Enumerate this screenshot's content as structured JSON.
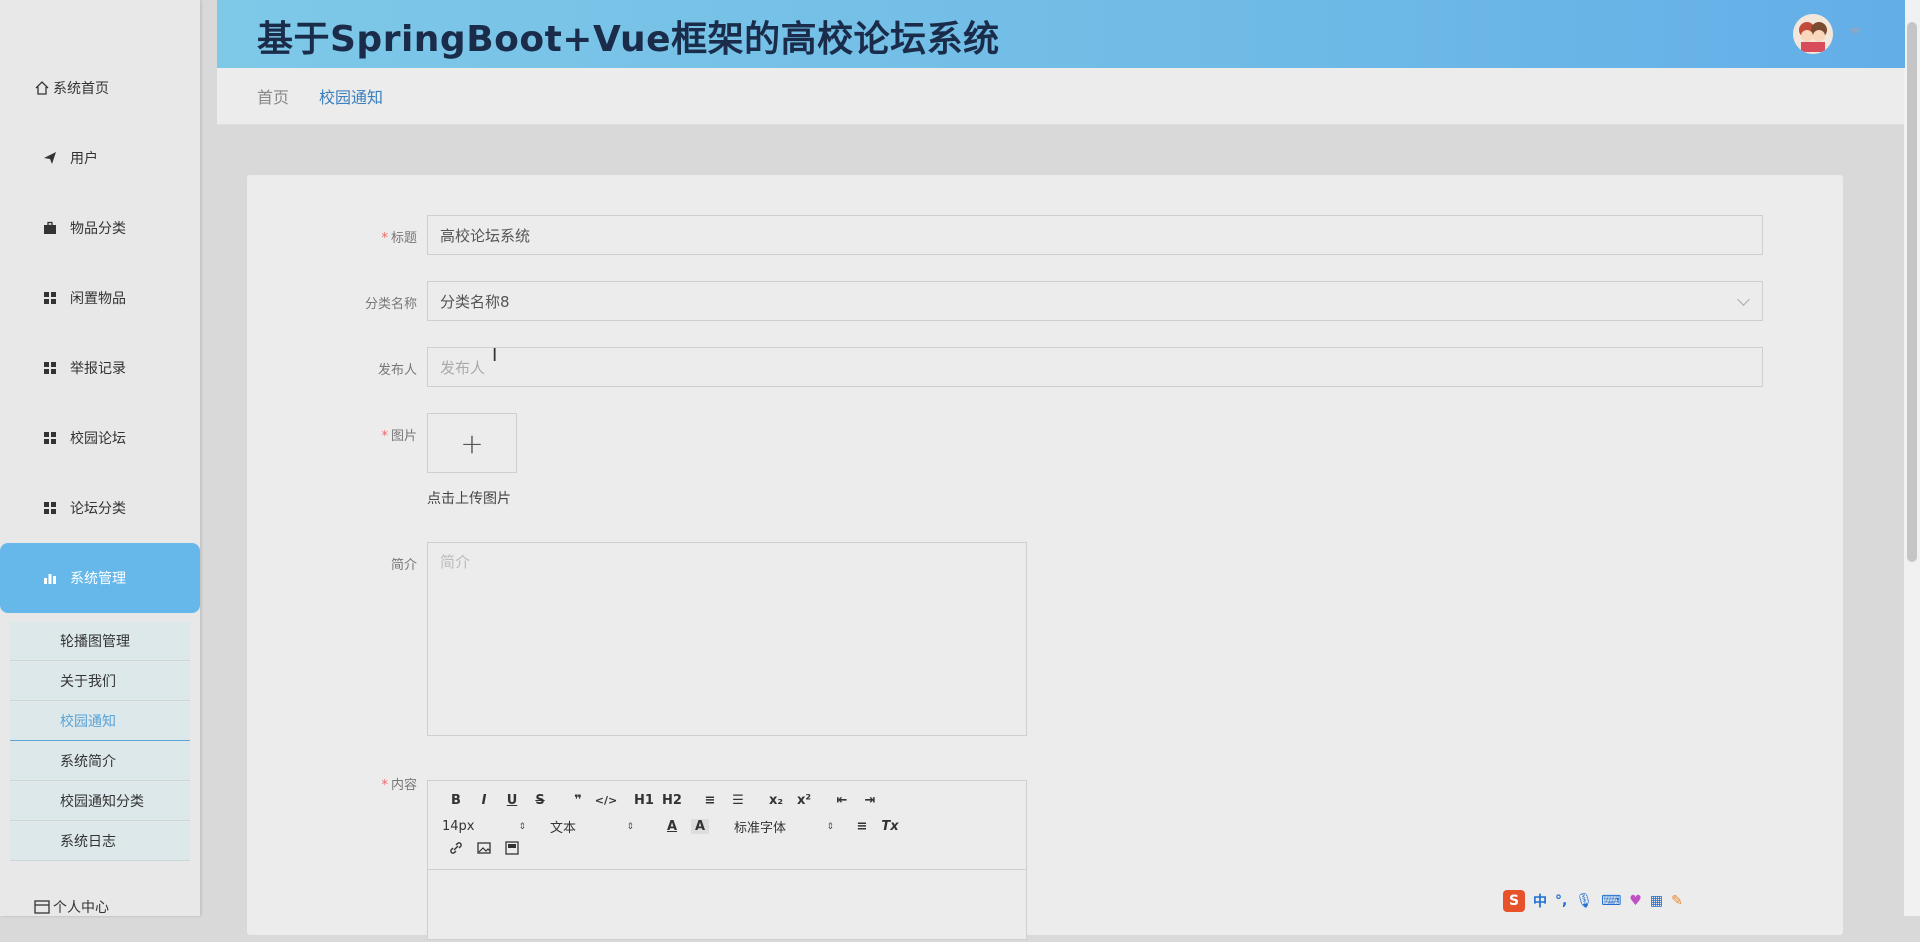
{
  "app": {
    "title": "基于SpringBoot+Vue框架的高校论坛系统"
  },
  "sidebar": {
    "items": [
      {
        "label": "系统首页",
        "icon": "home-icon"
      },
      {
        "label": "用户",
        "icon": "send-icon"
      },
      {
        "label": "物品分类",
        "icon": "briefcase-icon"
      },
      {
        "label": "闲置物品",
        "icon": "grid-icon"
      },
      {
        "label": "举报记录",
        "icon": "grid-icon"
      },
      {
        "label": "校园论坛",
        "icon": "grid-icon"
      },
      {
        "label": "论坛分类",
        "icon": "grid-icon"
      },
      {
        "label": "系统管理",
        "icon": "bar-chart-icon"
      },
      {
        "label": "个人中心",
        "icon": "card-icon"
      }
    ],
    "submenu": [
      {
        "label": "轮播图管理"
      },
      {
        "label": "关于我们"
      },
      {
        "label": "校园通知"
      },
      {
        "label": "系统简介"
      },
      {
        "label": "校园通知分类"
      },
      {
        "label": "系统日志"
      }
    ]
  },
  "breadcrumb": {
    "home": "首页",
    "current": "校园通知"
  },
  "form": {
    "title_label": "标题",
    "title_value": "高校论坛系统",
    "category_label": "分类名称",
    "category_value": "分类名称8",
    "publisher_label": "发布人",
    "publisher_placeholder": "发布人",
    "image_label": "图片",
    "upload_plus": "+",
    "upload_hint": "点击上传图片",
    "intro_label": "简介",
    "intro_placeholder": "简介",
    "content_label": "内容",
    "required_mark": "*"
  },
  "editor": {
    "row1": [
      "B",
      "I",
      "U",
      "S",
      "❞",
      "</>",
      "H1",
      "H2",
      "≡",
      "☰",
      "x₂",
      "x²",
      "⇤",
      "⇥"
    ],
    "font_size": "14px",
    "format": "文本",
    "color_btn": "A",
    "bg_btn": "A",
    "font_family": "标准字体",
    "align_btn": "≡",
    "clear_btn": "Tx",
    "row3": [
      "link-icon",
      "image-icon",
      "video-icon"
    ]
  },
  "ime": {
    "logo": "S",
    "lang": "中",
    "punct": "°,"
  },
  "colors": {
    "header_start": "#7ec8e8",
    "header_end": "#64aee8",
    "active_menu": "#66b8ea",
    "link": "#3a7fbf",
    "required": "#e66666"
  }
}
